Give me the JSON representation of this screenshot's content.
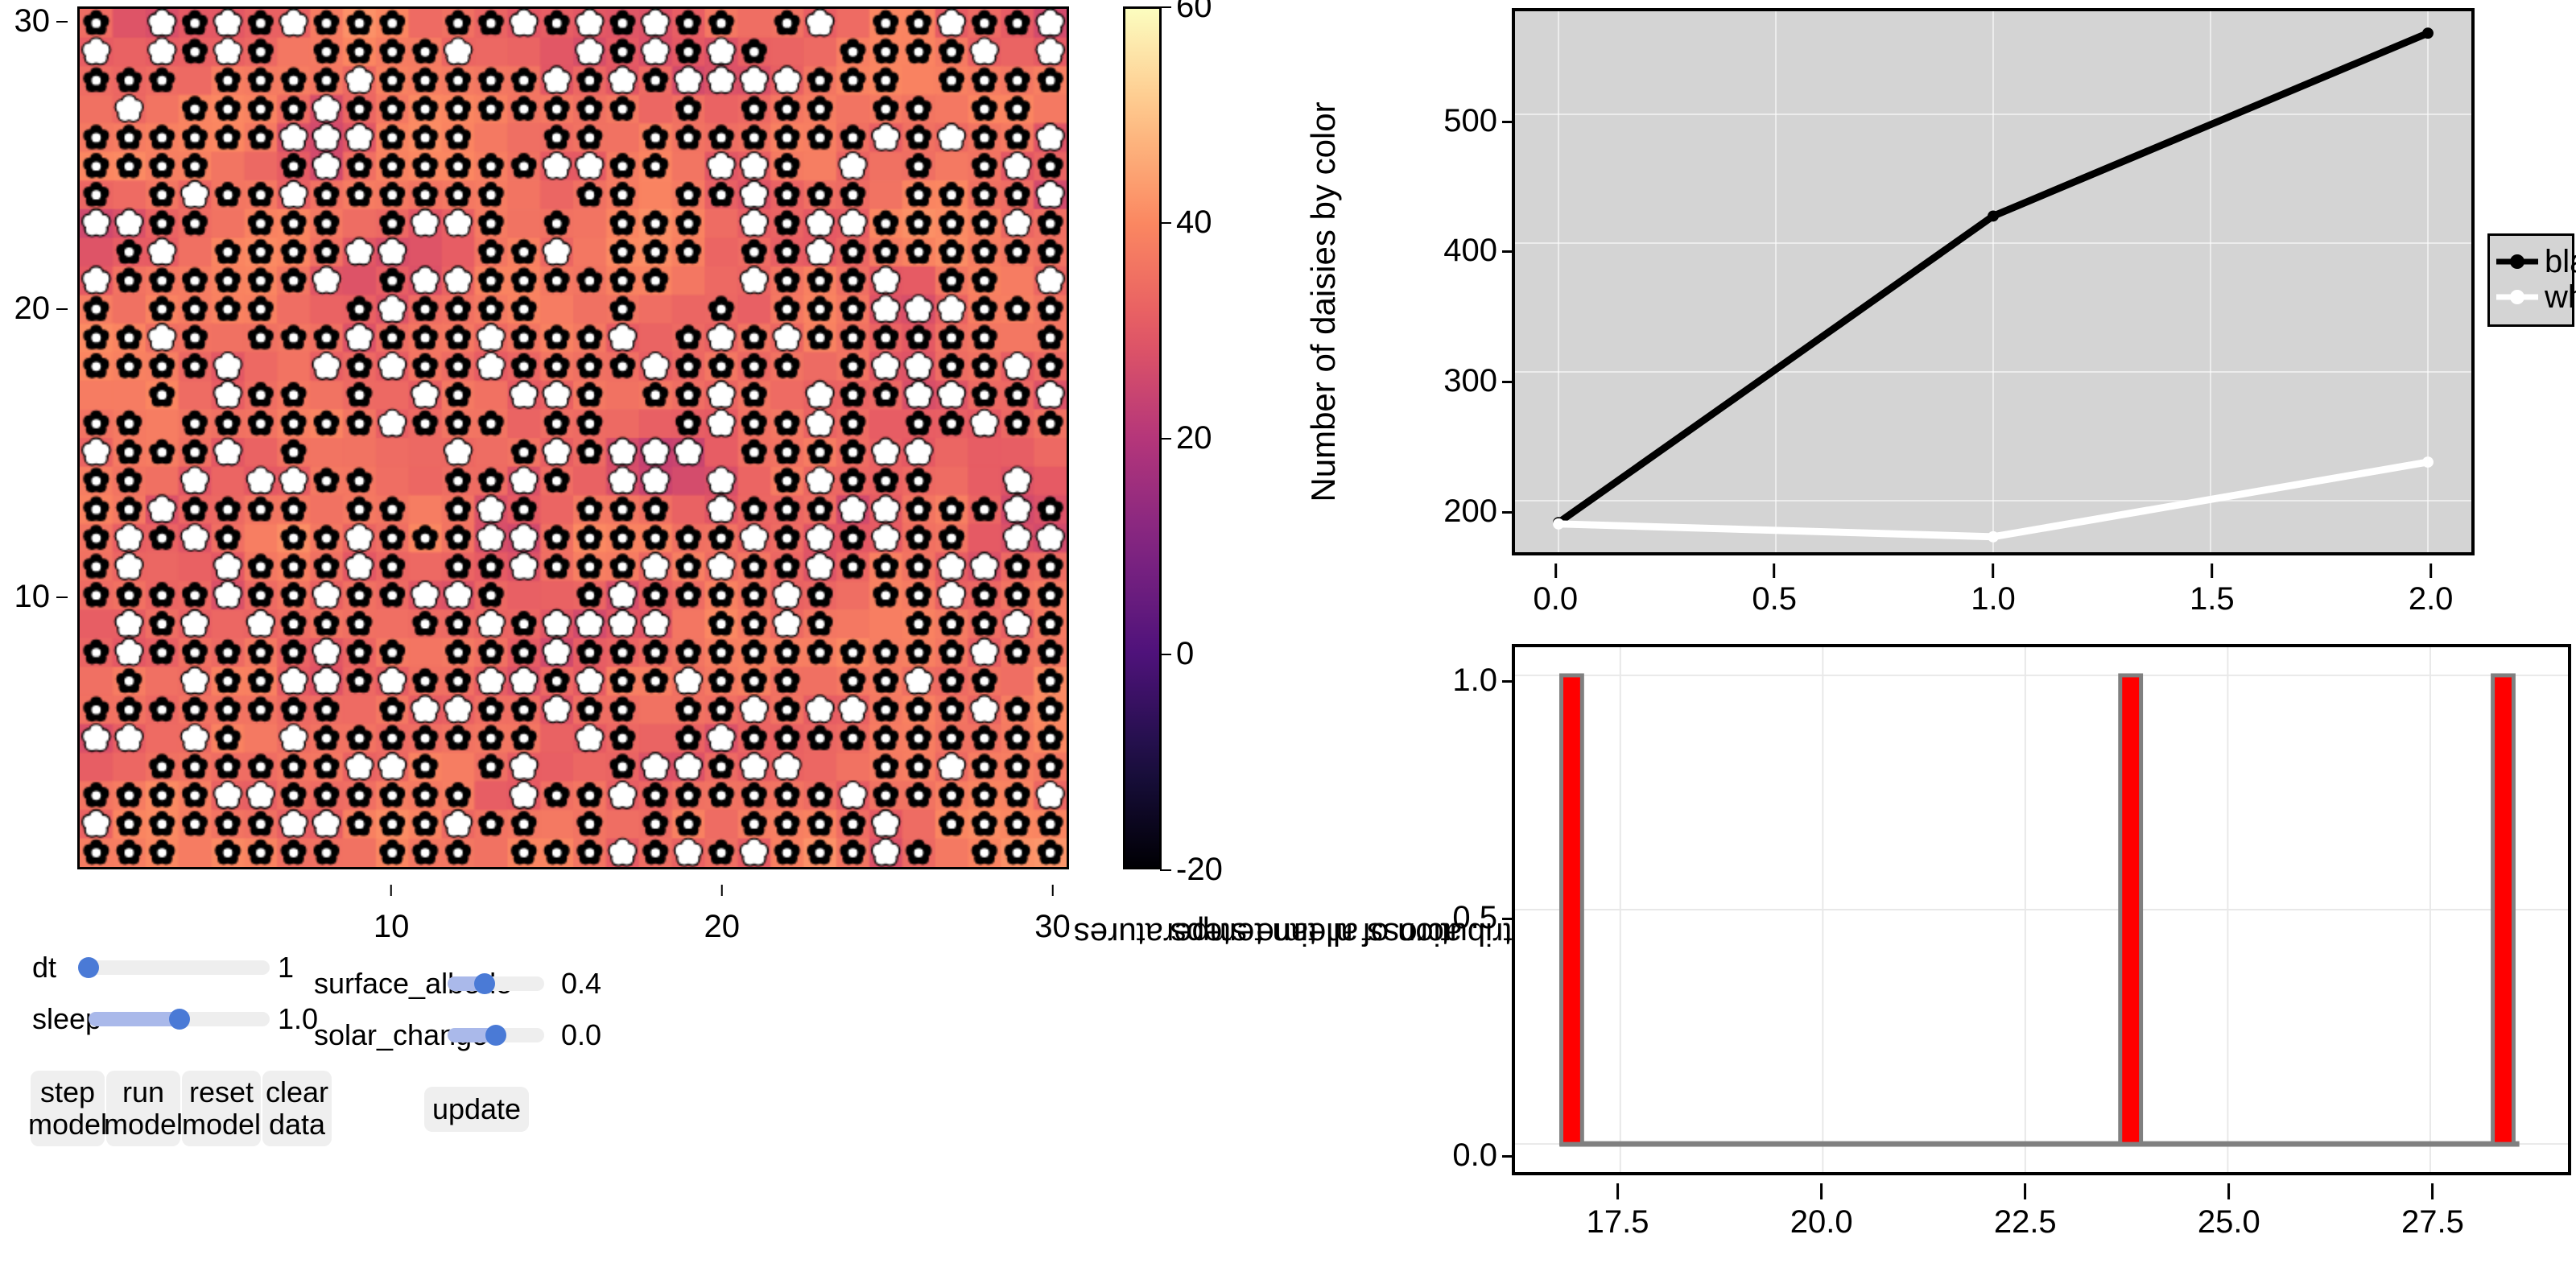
{
  "heatmap": {
    "title": "",
    "x_ticks": [
      {
        "label": "10",
        "pos": 10
      },
      {
        "label": "20",
        "pos": 20
      },
      {
        "label": "30",
        "pos": 30
      }
    ],
    "y_ticks": [
      {
        "label": "10",
        "pos": 10
      },
      {
        "label": "20",
        "pos": 20
      },
      {
        "label": "30",
        "pos": 30
      }
    ],
    "grid_size": 30,
    "colormap": "magma",
    "colorbar": {
      "vmin": -20,
      "vmax": 60,
      "ticks": [
        {
          "label": "60",
          "value": 60
        },
        {
          "label": "40",
          "value": 40
        },
        {
          "label": "20",
          "value": 20
        },
        {
          "label": "0",
          "value": 0
        },
        {
          "label": "-20",
          "value": -20
        }
      ],
      "stops": [
        "#000004",
        "#1c1044",
        "#4f127b",
        "#812581",
        "#b5367a",
        "#e55964",
        "#fb8761",
        "#fec287",
        "#fcfdbf"
      ]
    },
    "daisy_colors": {
      "black": "#000000",
      "white": "#ffffff"
    }
  },
  "controls": {
    "sliders": [
      {
        "name": "dt",
        "label": "dt",
        "value": "1",
        "fill_fraction": 0.0
      },
      {
        "name": "sleep",
        "label": "sleep",
        "value": "1.0",
        "fill_fraction": 0.5
      },
      {
        "name": "surface_albedo",
        "label": "surface_albedo",
        "value": "0.4",
        "fill_fraction": 0.38
      },
      {
        "name": "solar_change",
        "label": "solar_change",
        "value": "0.0",
        "fill_fraction": 0.5
      }
    ],
    "buttons": [
      {
        "name": "step-model",
        "label": "step\nmodel"
      },
      {
        "name": "run-model",
        "label": "run\nmodel"
      },
      {
        "name": "reset-model",
        "label": "reset\nmodel"
      },
      {
        "name": "clear-data",
        "label": "clear\ndata"
      },
      {
        "name": "update",
        "label": "update"
      }
    ]
  },
  "chart_data": [
    {
      "id": "daisy-count-line",
      "type": "line",
      "title": "",
      "xlabel": "",
      "ylabel": "Number of daisies by color",
      "x": [
        0.0,
        1.0,
        2.0
      ],
      "xlim": [
        -0.1,
        2.1
      ],
      "ylim": [
        160,
        580
      ],
      "xticks": [
        0.0,
        0.5,
        1.0,
        1.5,
        2.0
      ],
      "xtick_labels": [
        "0.0",
        "0.5",
        "1.0",
        "1.5",
        "2.0"
      ],
      "yticks": [
        200,
        300,
        400,
        500
      ],
      "ytick_labels": [
        "200",
        "300",
        "400",
        "500"
      ],
      "grid": true,
      "plot_bg": "#d4d4d4",
      "legend_position": "right",
      "series": [
        {
          "name": "black",
          "color": "#000000",
          "values": [
            183,
            421,
            563
          ]
        },
        {
          "name": "white",
          "color": "#ffffff",
          "values": [
            182,
            172,
            230
          ]
        }
      ]
    },
    {
      "id": "mean-temp-histogram",
      "type": "bar",
      "title": "",
      "xlabel": "",
      "ylabel": "Distribution of mean temperatures\nacross all time steps",
      "categories": [
        "16.9",
        "23.8",
        "28.4"
      ],
      "values": [
        1.0,
        1.0,
        1.0
      ],
      "bar_color": "#ff0000",
      "bar_edge_color": "#808080",
      "xlim": [
        16.2,
        29.2
      ],
      "ylim": [
        -0.06,
        1.06
      ],
      "xticks": [
        17.5,
        20.0,
        22.5,
        25.0,
        27.5
      ],
      "xtick_labels": [
        "17.5",
        "20.0",
        "22.5",
        "25.0",
        "27.5"
      ],
      "yticks": [
        0.0,
        0.5,
        1.0
      ],
      "ytick_labels": [
        "0.0",
        "0.5",
        "1.0"
      ],
      "grid": true,
      "plot_bg": "#ffffff"
    }
  ]
}
